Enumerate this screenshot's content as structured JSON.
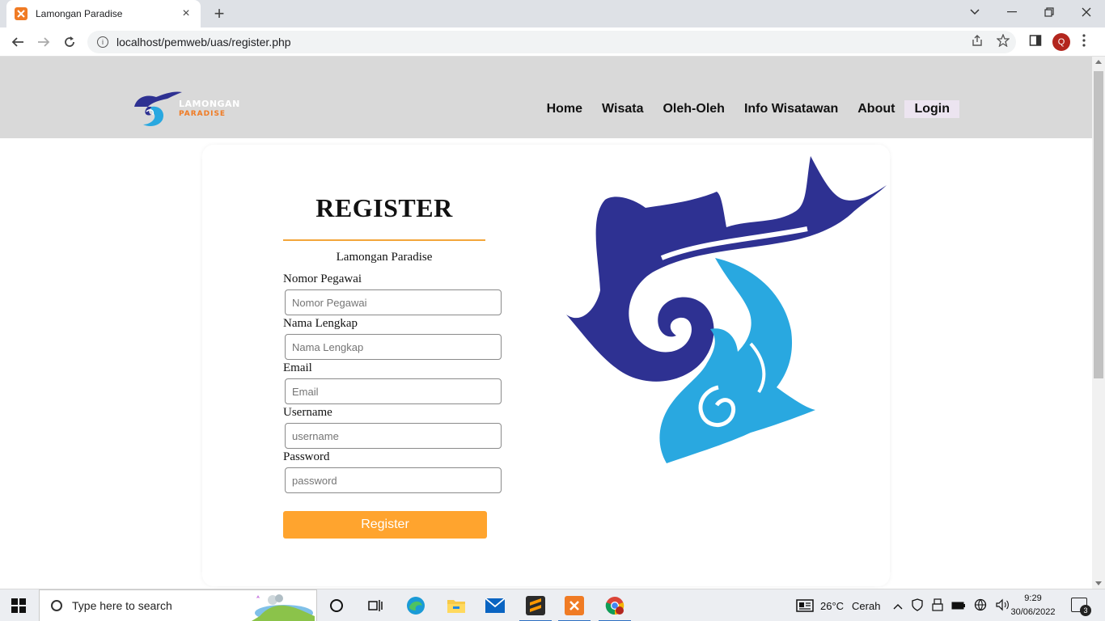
{
  "browser": {
    "tab_title": "Lamongan Paradise",
    "tab_close": "×",
    "new_tab": "+",
    "url": "localhost/pemweb/uas/register.php",
    "profile_initial": "Q"
  },
  "site": {
    "logo_line1": "LAMONGAN",
    "logo_line2": "PARADISE",
    "nav": [
      "Home",
      "Wisata",
      "Oleh-Oleh",
      "Info Wisatawan",
      "About",
      "Login"
    ],
    "active_nav": "Login"
  },
  "form": {
    "title": "REGISTER",
    "subtitle": "Lamongan Paradise",
    "fields": [
      {
        "label": "Nomor Pegawai",
        "placeholder": "Nomor Pegawai"
      },
      {
        "label": "Nama Lengkap",
        "placeholder": "Nama Lengkap"
      },
      {
        "label": "Email",
        "placeholder": "Email"
      },
      {
        "label": "Username",
        "placeholder": "username"
      },
      {
        "label": "Password",
        "placeholder": "password"
      }
    ],
    "submit_label": "Register"
  },
  "taskbar": {
    "search_placeholder": "Type here to search",
    "weather_temp": "26°C",
    "weather_desc": "Cerah",
    "time": "9:29",
    "date": "30/06/2022",
    "notification_count": "3"
  },
  "colors": {
    "accent_orange": "#ffa42e",
    "logo_dark_blue": "#2e3192",
    "logo_light_blue": "#29a8e0",
    "header_gray": "#d9d9d9"
  }
}
